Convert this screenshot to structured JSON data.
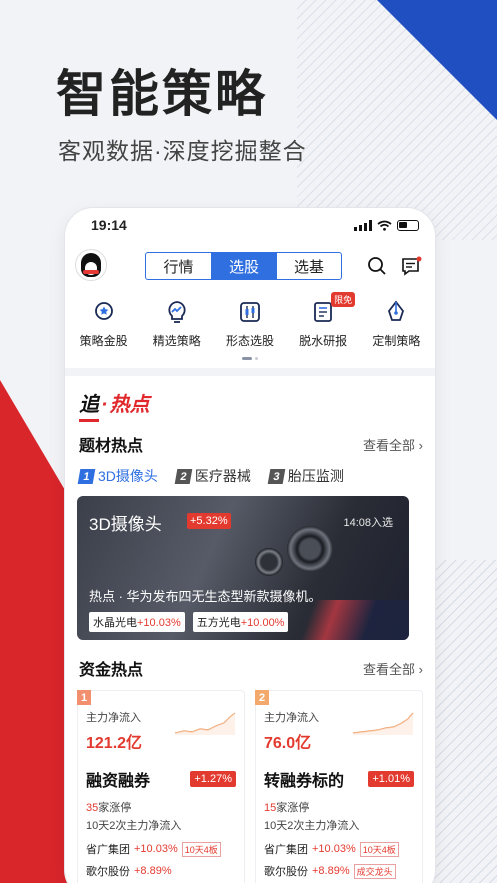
{
  "headline": "智能策略",
  "subline": "客观数据·深度挖掘整合",
  "status_bar": {
    "time": "19:14"
  },
  "segmented": [
    "行情",
    "选股",
    "选基"
  ],
  "menu": [
    {
      "label": "策略金股",
      "icon": "medal-icon"
    },
    {
      "label": "精选策略",
      "icon": "bulb-chart-icon"
    },
    {
      "label": "形态选股",
      "icon": "candlestick-icon"
    },
    {
      "label": "脱水研报",
      "icon": "report-icon",
      "badge": "限免"
    },
    {
      "label": "定制策略",
      "icon": "pen-nib-icon"
    }
  ],
  "hot": {
    "prefix": "追",
    "dot": "·",
    "suffix": "热点"
  },
  "topic": {
    "title": "题材热点",
    "see_all": "查看全部 ›",
    "tabs": [
      {
        "num": "1",
        "label": "3D摄像头"
      },
      {
        "num": "2",
        "label": "医疗器械"
      },
      {
        "num": "3",
        "label": "胎压监测"
      }
    ],
    "card": {
      "title": "3D摄像头",
      "pct": "+5.32%",
      "time": "14:08入选",
      "news": "热点 · 华为发布四无生态型新款摄像机。",
      "tags": [
        {
          "name": "水晶光电",
          "pct": "+10.03%"
        },
        {
          "name": "五方光电",
          "pct": "+10.00%"
        }
      ]
    }
  },
  "funds": {
    "title": "资金热点",
    "see_all": "查看全部 ›",
    "cards": [
      {
        "num": "1",
        "flow_label": "主力净流入",
        "flow_value": "121.2亿",
        "name": "融资融券",
        "pct": "+1.27%",
        "limit_count": "35",
        "limit_text": "家涨停",
        "inflow": "10天2次主力净流入",
        "stocks": [
          {
            "name": "省广集团",
            "pct": "+10.03%",
            "tag": "10天4板"
          },
          {
            "name": "歌尔股份",
            "pct": "+8.89%",
            "tag": ""
          }
        ]
      },
      {
        "num": "2",
        "flow_label": "主力净流入",
        "flow_value": "76.0亿",
        "name": "转融券标的",
        "pct": "+1.01%",
        "limit_count": "15",
        "limit_text": "家涨停",
        "inflow": "10天2次主力净流入",
        "stocks": [
          {
            "name": "省广集团",
            "pct": "+10.03%",
            "tag": "10天4板"
          },
          {
            "name": "歌尔股份",
            "pct": "+8.89%",
            "tag": "成交龙头"
          }
        ]
      }
    ]
  },
  "colors": {
    "accent": "#2f6fe0",
    "red": "#e33a2f",
    "blue_corner": "#1f4fc1"
  }
}
